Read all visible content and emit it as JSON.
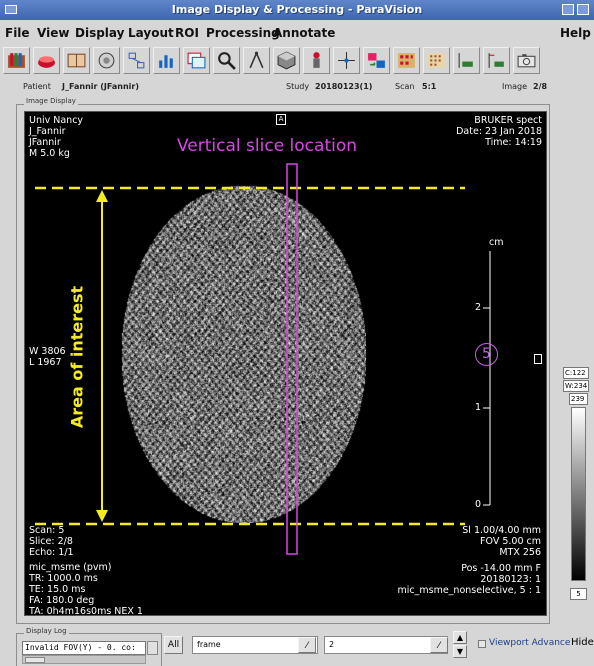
{
  "window": {
    "title": "Image Display & Processing - ParaVision"
  },
  "menu": {
    "file": "File",
    "view": "View",
    "display": "Display",
    "layout": "Layout",
    "roi": "ROI",
    "processing": "Processing",
    "annotate": "Annotate",
    "help": "Help"
  },
  "toolbar_icons": [
    "folder-icon",
    "red-book-icon",
    "book-icon",
    "globe-icon",
    "network-icon",
    "histogram-icon",
    "window-stack-icon",
    "magnifier-icon",
    "compass-icon",
    "cube-icon",
    "person-icon",
    "crosshair-icon",
    "exchange-icon",
    "grid-icon",
    "grid-dotted-icon",
    "profile-horizontal-icon",
    "profile-vertical-icon",
    "camera-icon"
  ],
  "info": {
    "patient_label": "Patient",
    "patient_value": "J_Fannir (JFannir)",
    "study_label": "Study",
    "study_value": "20180123(1)",
    "scan_label": "Scan",
    "scan_value": "5:1",
    "image_label": "Image",
    "image_value": "2/8"
  },
  "image_display": {
    "frame_label": "Image Display",
    "top_left": [
      "Univ Nancy",
      "J_Fannir",
      "JFannir",
      "M 5.0 kg"
    ],
    "top_right": [
      "BRUKER spect",
      "Date: 23 Jan 2018",
      "Time: 14:19"
    ],
    "center_marker": "A",
    "wl": [
      "W 3806",
      "L 1967"
    ],
    "bottom_left": [
      "Scan: 5",
      "Slice: 2/8",
      "Echo: 1/1",
      "mic_msme (pvm)",
      "TR: 1000.0 ms",
      "TE: 15.0 ms",
      "FA: 180.0 deg",
      "TA: 0h4m16s0ms NEX 1"
    ],
    "bottom_right_1": [
      "Sl 1.00/4.00 mm",
      "FOV 5.00 cm",
      "MTX 256"
    ],
    "bottom_right_2": [
      "Pos -14.00 mm F",
      "20180123: 1",
      "mic_msme_nonselective, 5 : 1"
    ],
    "scale_unit": "cm",
    "scale_ticks": [
      "2",
      "1",
      "0"
    ],
    "annotation_title": "Vertical  slice location",
    "annotation_aoi": "Area of interest",
    "annotation_number": "5",
    "colors": {
      "magenta": "#d946e6",
      "yellow": "#f5ec20",
      "background": "#000000"
    }
  },
  "window_panel": {
    "c_value": "C:122",
    "w_value": "W:234",
    "max_value": "239",
    "min_value": "5"
  },
  "display_log": {
    "frame_label": "Display Log",
    "log_text": "Invalid FOV(Y) - 0. co:",
    "all_button": "All",
    "frame_field": "frame",
    "count_field": "2",
    "viewport_advance": "Viewport Advance",
    "hide_button": "Hide"
  }
}
